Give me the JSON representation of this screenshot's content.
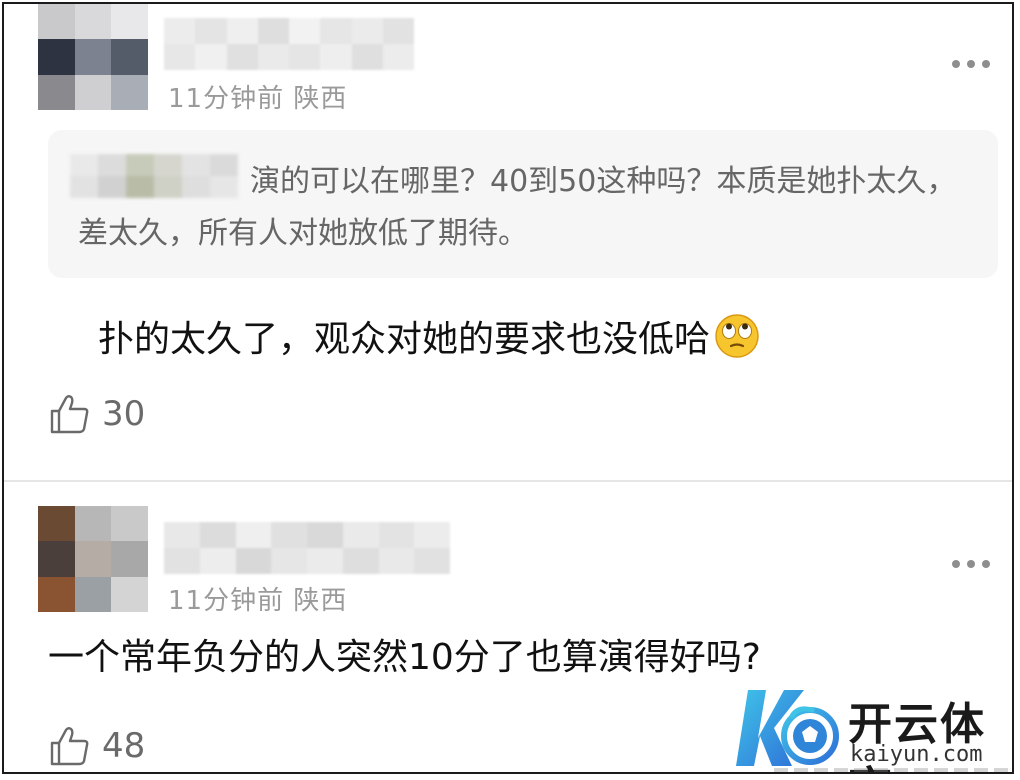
{
  "comments": [
    {
      "meta": "11分钟前 陕西",
      "quote": "演的可以在哪里？40到50这种吗？本质是她扑太久，差太久，所有人对她放低了期待。",
      "text": "扑的太久了，观众对她的要求也没低哈",
      "emoji": "eye-roll-emoji",
      "likes": "30"
    },
    {
      "meta": "11分钟前 陕西",
      "text": "一个常年负分的人突然10分了也算演得好吗?",
      "likes": "48"
    }
  ],
  "watermark": {
    "name": "开云体育",
    "url": "kaiyun.com",
    "logo": "kaiyun-logo"
  },
  "colors": {
    "meta": "#9a9a9a",
    "quote_bg": "#f6f6f6",
    "quote_text": "#666666",
    "body_text": "#111111",
    "logo_blue": "#2f86d8",
    "logo_cyan": "#3fc4e8"
  }
}
